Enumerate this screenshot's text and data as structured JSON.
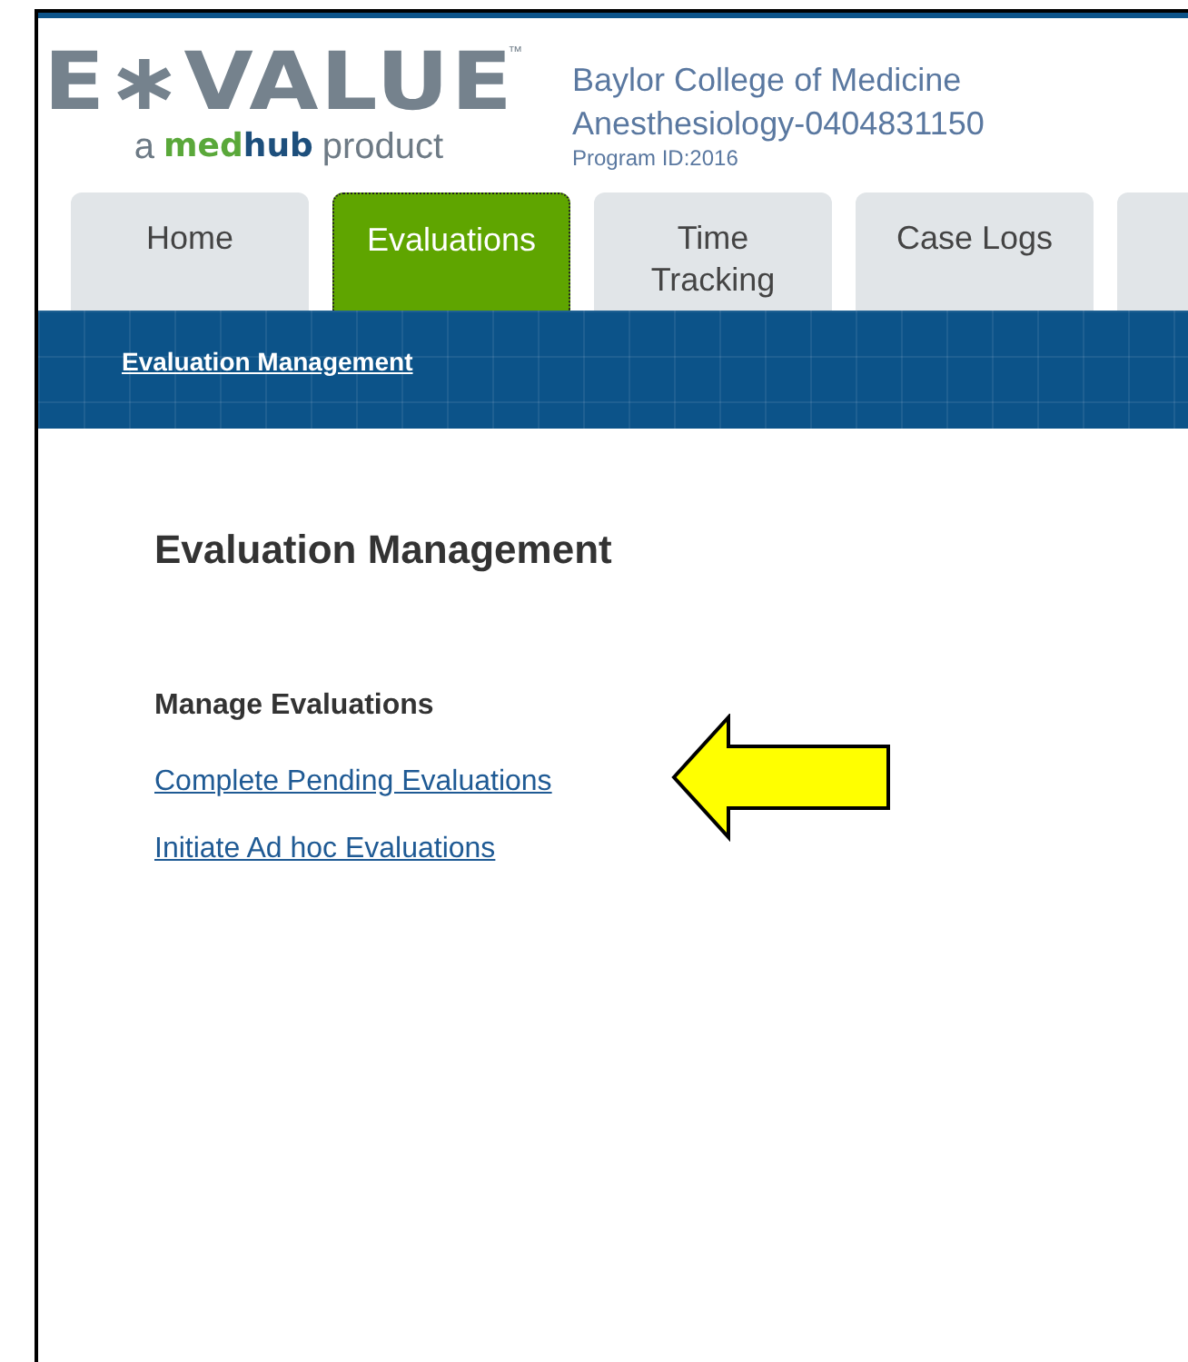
{
  "logo": {
    "wordmark": "E∗VALUE",
    "trademark": "™",
    "tagline": [
      {
        "text": "a",
        "kind": "plain"
      },
      {
        "text": "med",
        "kind": "brand-green"
      },
      {
        "text": "hub",
        "kind": "brand-blue"
      },
      {
        "text": "product",
        "kind": "plain"
      }
    ]
  },
  "organization": {
    "institution": "Baylor College of Medicine",
    "program": "Anesthesiology-0404831150",
    "program_id": "Program ID:2016"
  },
  "tabs": [
    {
      "label": "Home",
      "selected": false
    },
    {
      "label": "Evaluations",
      "selected": true
    },
    {
      "label": "Time\nTracking",
      "selected": false
    },
    {
      "label": "Case Logs",
      "selected": false
    },
    {
      "selected": false
    }
  ],
  "breadcrumb": "Evaluation Management",
  "page_title": "Evaluation Management",
  "section": {
    "heading": "Manage Evaluations",
    "links": [
      "Complete Pending Evaluations",
      "Initiate Ad hoc Evaluations"
    ]
  },
  "annotation": {
    "kind": "arrow"
  }
}
